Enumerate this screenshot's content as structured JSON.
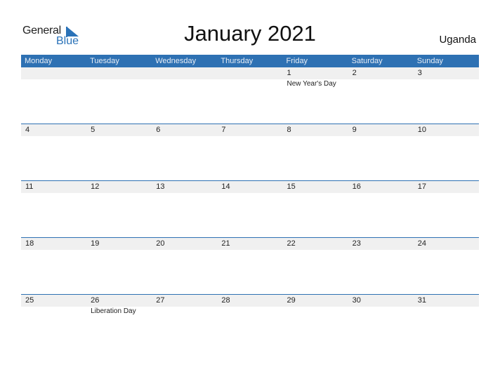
{
  "logo": {
    "general": "General",
    "blue": "Blue"
  },
  "title": "January 2021",
  "country": "Uganda",
  "accent_color": "#2e71b3",
  "weekdays": [
    "Monday",
    "Tuesday",
    "Wednesday",
    "Thursday",
    "Friday",
    "Saturday",
    "Sunday"
  ],
  "weeks": [
    [
      {
        "day": ""
      },
      {
        "day": ""
      },
      {
        "day": ""
      },
      {
        "day": ""
      },
      {
        "day": "1",
        "holiday": "New Year's Day"
      },
      {
        "day": "2"
      },
      {
        "day": "3"
      }
    ],
    [
      {
        "day": "4"
      },
      {
        "day": "5"
      },
      {
        "day": "6"
      },
      {
        "day": "7"
      },
      {
        "day": "8"
      },
      {
        "day": "9"
      },
      {
        "day": "10"
      }
    ],
    [
      {
        "day": "11"
      },
      {
        "day": "12"
      },
      {
        "day": "13"
      },
      {
        "day": "14"
      },
      {
        "day": "15"
      },
      {
        "day": "16"
      },
      {
        "day": "17"
      }
    ],
    [
      {
        "day": "18"
      },
      {
        "day": "19"
      },
      {
        "day": "20"
      },
      {
        "day": "21"
      },
      {
        "day": "22"
      },
      {
        "day": "23"
      },
      {
        "day": "24"
      }
    ],
    [
      {
        "day": "25"
      },
      {
        "day": "26",
        "holiday": "Liberation Day"
      },
      {
        "day": "27"
      },
      {
        "day": "28"
      },
      {
        "day": "29"
      },
      {
        "day": "30"
      },
      {
        "day": "31"
      }
    ]
  ]
}
